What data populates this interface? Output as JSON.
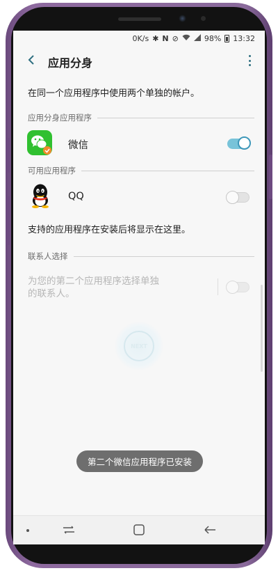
{
  "status_bar": {
    "net_speed": "0K/s",
    "battery_percent": "98%",
    "time": "13:32",
    "icons": [
      "bluetooth-icon",
      "nfc-icon",
      "mute-icon",
      "wifi-icon",
      "signal-icon",
      "battery-icon"
    ]
  },
  "app_bar": {
    "title": "应用分身",
    "back_icon": "back-arrow-icon",
    "more_icon": "more-vertical-icon"
  },
  "description": "在同一个应用程序中使用两个单独的帐户。",
  "sections": {
    "cloned_apps": {
      "header": "应用分身应用程序",
      "items": [
        {
          "name": "微信",
          "icon": "wechat-icon",
          "enabled": true
        }
      ]
    },
    "available_apps": {
      "header": "可用应用程序",
      "items": [
        {
          "name": "QQ",
          "icon": "qq-icon",
          "enabled": false
        }
      ]
    },
    "supported_note": "支持的应用程序在安装后将显示在这里。",
    "contacts": {
      "header": "联系人选择",
      "option_line1": "为您的第二个应用程序选择单独",
      "option_line2": "的联系人。",
      "enabled": false
    }
  },
  "toast": "第二个微信应用程序已安装",
  "watermark": "NEXT",
  "nav_bar": {
    "icons": [
      "nav-dot-icon",
      "recent-apps-icon",
      "home-icon",
      "back-icon"
    ]
  },
  "colors": {
    "accent": "#2f6f81",
    "toggle_on": "#3d97b9",
    "wechat_green": "#30c030",
    "frame": "#8a6a9b"
  }
}
